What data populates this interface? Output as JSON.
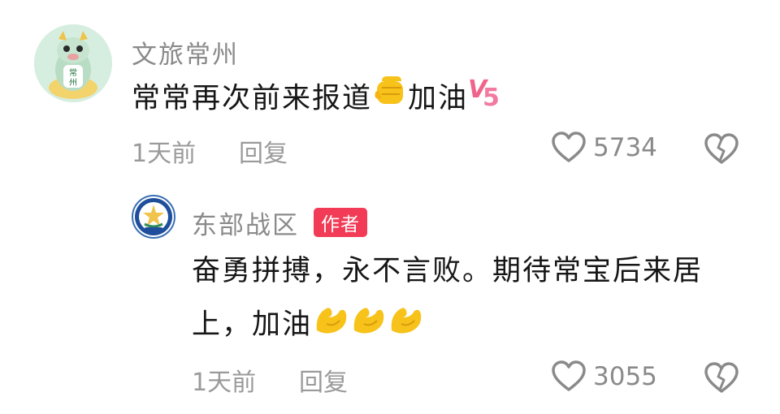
{
  "comments": [
    {
      "username": "文旅常州",
      "avatar_text": "常\n州",
      "text_before": "常常再次前来报道",
      "text_after": "加油",
      "time": "1天前",
      "reply_label": "回复",
      "like_count": "5734"
    }
  ],
  "reply": {
    "username": "东部战区",
    "badge": "作者",
    "line1": "奋勇拼搏，永不言败。期待常宝后来居",
    "line2_text": "上，加油",
    "time": "1天前",
    "reply_label": "回复",
    "like_count": "3055",
    "avatar_text": "东部战区"
  },
  "colors": {
    "badge": "#f23b56",
    "emoji_yellow": "#f7c21a",
    "v5_pink": "#f0648c",
    "meta_gray": "#9a9a9a"
  },
  "icons": [
    "heart-outline-icon",
    "broken-heart-icon",
    "fist-emoji-icon",
    "flexed-biceps-emoji-icon",
    "v5-emoji-icon"
  ]
}
